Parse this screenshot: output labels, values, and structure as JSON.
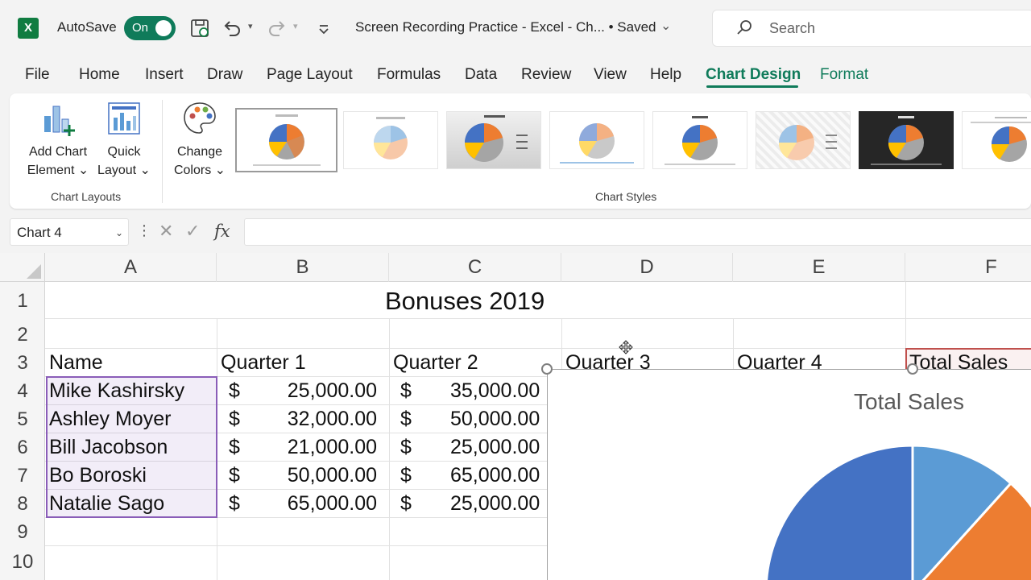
{
  "titlebar": {
    "logo_letter": "X",
    "autosave_label": "AutoSave",
    "toggle_label": "On",
    "document_title": "Screen Recording Practice - Excel - Ch... • Saved",
    "title_chevron": "⌄",
    "search_placeholder": "Search"
  },
  "tabs": [
    {
      "label": "File"
    },
    {
      "label": "Home"
    },
    {
      "label": "Insert"
    },
    {
      "label": "Draw"
    },
    {
      "label": "Page Layout"
    },
    {
      "label": "Formulas"
    },
    {
      "label": "Data"
    },
    {
      "label": "Review"
    },
    {
      "label": "View"
    },
    {
      "label": "Help"
    },
    {
      "label": "Chart Design"
    },
    {
      "label": "Format"
    }
  ],
  "ribbon": {
    "add_chart_line1": "Add Chart",
    "add_chart_line2": "Element ⌄",
    "quick_layout_line1": "Quick",
    "quick_layout_line2": "Layout ⌄",
    "change_colors_line1": "Change",
    "change_colors_line2": "Colors ⌄",
    "group_chart_layouts": "Chart Layouts",
    "group_chart_styles": "Chart Styles"
  },
  "formula_bar": {
    "name_box": "Chart 4",
    "name_box_chevron": "⌄",
    "dots": "⋮",
    "cancel_glyph": "✕",
    "enter_glyph": "✓",
    "fx_label": "fx",
    "formula_value": ""
  },
  "sheet": {
    "columns": [
      "A",
      "B",
      "C",
      "D",
      "E",
      "F"
    ],
    "rows": [
      "1",
      "2",
      "3",
      "4",
      "5",
      "6",
      "7",
      "8",
      "9",
      "10"
    ],
    "title": "Bonuses 2019",
    "headers": [
      "Name",
      "Quarter 1",
      "Quarter 2",
      "Quarter 3",
      "Quarter 4",
      "Total Sales"
    ],
    "currency_symbol": "$",
    "data_rows": [
      {
        "name": "Mike Kashirsky",
        "q1": "25,000.00",
        "q2": "35,000.00"
      },
      {
        "name": "Ashley Moyer",
        "q1": "32,000.00",
        "q2": "50,000.00"
      },
      {
        "name": "Bill Jacobson",
        "q1": "21,000.00",
        "q2": "25,000.00"
      },
      {
        "name": "Bo Boroski",
        "q1": "50,000.00",
        "q2": "65,000.00"
      },
      {
        "name": "Natalie Sago",
        "q1": "65,000.00",
        "q2": "25,000.00"
      }
    ]
  },
  "chart": {
    "title": "Total Sales",
    "colors": [
      "#4472c4",
      "#5b9bd5",
      "#ed7d31"
    ]
  },
  "colors": {
    "accent": "#0f7b5a",
    "selection": "#8a5db8"
  }
}
